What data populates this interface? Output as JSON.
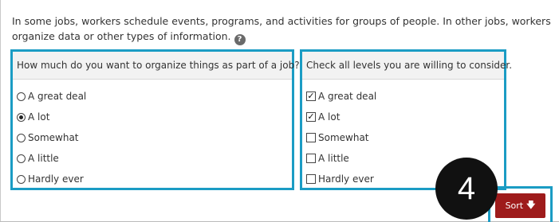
{
  "intro_text": "In some jobs, workers schedule events, programs, and activities for groups of people. In other jobs, workers organize data or other types of information.",
  "help_icon": "question-circle-icon",
  "left_panel": {
    "heading": "How much do you want to organize things as part of a job?",
    "options": [
      {
        "label": "A great deal",
        "checked": false
      },
      {
        "label": "A lot",
        "checked": true
      },
      {
        "label": "Somewhat",
        "checked": false
      },
      {
        "label": "A little",
        "checked": false
      },
      {
        "label": "Hardly ever",
        "checked": false
      }
    ]
  },
  "right_panel": {
    "heading": "Check all levels you are willing to consider.",
    "options": [
      {
        "label": "A great deal",
        "checked": true
      },
      {
        "label": "A lot",
        "checked": true
      },
      {
        "label": "Somewhat",
        "checked": false
      },
      {
        "label": "A little",
        "checked": false
      },
      {
        "label": "Hardly ever",
        "checked": false
      }
    ]
  },
  "step_badge": "4",
  "sort_button": {
    "label": "Sort",
    "icon": "arrow-down-icon"
  },
  "colors": {
    "highlight": "#1b9cc4",
    "sort_button": "#9e1b1b"
  }
}
